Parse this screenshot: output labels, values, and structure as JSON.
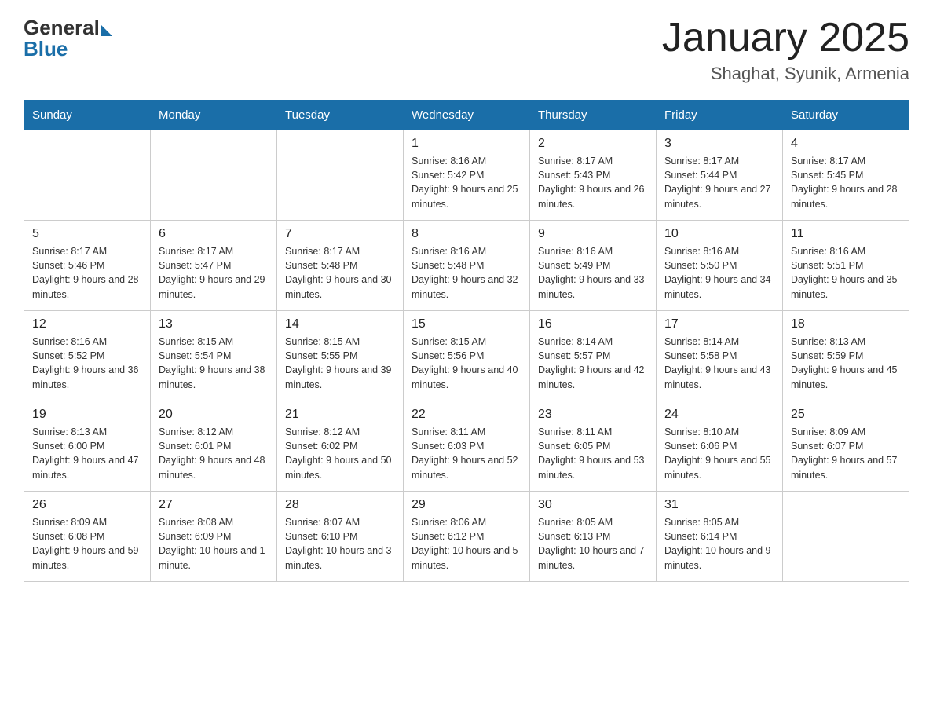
{
  "logo": {
    "general": "General",
    "blue": "Blue"
  },
  "title": "January 2025",
  "subtitle": "Shaghat, Syunik, Armenia",
  "weekdays": [
    "Sunday",
    "Monday",
    "Tuesday",
    "Wednesday",
    "Thursday",
    "Friday",
    "Saturday"
  ],
  "weeks": [
    [
      {
        "day": "",
        "info": ""
      },
      {
        "day": "",
        "info": ""
      },
      {
        "day": "",
        "info": ""
      },
      {
        "day": "1",
        "info": "Sunrise: 8:16 AM\nSunset: 5:42 PM\nDaylight: 9 hours\nand 25 minutes."
      },
      {
        "day": "2",
        "info": "Sunrise: 8:17 AM\nSunset: 5:43 PM\nDaylight: 9 hours\nand 26 minutes."
      },
      {
        "day": "3",
        "info": "Sunrise: 8:17 AM\nSunset: 5:44 PM\nDaylight: 9 hours\nand 27 minutes."
      },
      {
        "day": "4",
        "info": "Sunrise: 8:17 AM\nSunset: 5:45 PM\nDaylight: 9 hours\nand 28 minutes."
      }
    ],
    [
      {
        "day": "5",
        "info": "Sunrise: 8:17 AM\nSunset: 5:46 PM\nDaylight: 9 hours\nand 28 minutes."
      },
      {
        "day": "6",
        "info": "Sunrise: 8:17 AM\nSunset: 5:47 PM\nDaylight: 9 hours\nand 29 minutes."
      },
      {
        "day": "7",
        "info": "Sunrise: 8:17 AM\nSunset: 5:48 PM\nDaylight: 9 hours\nand 30 minutes."
      },
      {
        "day": "8",
        "info": "Sunrise: 8:16 AM\nSunset: 5:48 PM\nDaylight: 9 hours\nand 32 minutes."
      },
      {
        "day": "9",
        "info": "Sunrise: 8:16 AM\nSunset: 5:49 PM\nDaylight: 9 hours\nand 33 minutes."
      },
      {
        "day": "10",
        "info": "Sunrise: 8:16 AM\nSunset: 5:50 PM\nDaylight: 9 hours\nand 34 minutes."
      },
      {
        "day": "11",
        "info": "Sunrise: 8:16 AM\nSunset: 5:51 PM\nDaylight: 9 hours\nand 35 minutes."
      }
    ],
    [
      {
        "day": "12",
        "info": "Sunrise: 8:16 AM\nSunset: 5:52 PM\nDaylight: 9 hours\nand 36 minutes."
      },
      {
        "day": "13",
        "info": "Sunrise: 8:15 AM\nSunset: 5:54 PM\nDaylight: 9 hours\nand 38 minutes."
      },
      {
        "day": "14",
        "info": "Sunrise: 8:15 AM\nSunset: 5:55 PM\nDaylight: 9 hours\nand 39 minutes."
      },
      {
        "day": "15",
        "info": "Sunrise: 8:15 AM\nSunset: 5:56 PM\nDaylight: 9 hours\nand 40 minutes."
      },
      {
        "day": "16",
        "info": "Sunrise: 8:14 AM\nSunset: 5:57 PM\nDaylight: 9 hours\nand 42 minutes."
      },
      {
        "day": "17",
        "info": "Sunrise: 8:14 AM\nSunset: 5:58 PM\nDaylight: 9 hours\nand 43 minutes."
      },
      {
        "day": "18",
        "info": "Sunrise: 8:13 AM\nSunset: 5:59 PM\nDaylight: 9 hours\nand 45 minutes."
      }
    ],
    [
      {
        "day": "19",
        "info": "Sunrise: 8:13 AM\nSunset: 6:00 PM\nDaylight: 9 hours\nand 47 minutes."
      },
      {
        "day": "20",
        "info": "Sunrise: 8:12 AM\nSunset: 6:01 PM\nDaylight: 9 hours\nand 48 minutes."
      },
      {
        "day": "21",
        "info": "Sunrise: 8:12 AM\nSunset: 6:02 PM\nDaylight: 9 hours\nand 50 minutes."
      },
      {
        "day": "22",
        "info": "Sunrise: 8:11 AM\nSunset: 6:03 PM\nDaylight: 9 hours\nand 52 minutes."
      },
      {
        "day": "23",
        "info": "Sunrise: 8:11 AM\nSunset: 6:05 PM\nDaylight: 9 hours\nand 53 minutes."
      },
      {
        "day": "24",
        "info": "Sunrise: 8:10 AM\nSunset: 6:06 PM\nDaylight: 9 hours\nand 55 minutes."
      },
      {
        "day": "25",
        "info": "Sunrise: 8:09 AM\nSunset: 6:07 PM\nDaylight: 9 hours\nand 57 minutes."
      }
    ],
    [
      {
        "day": "26",
        "info": "Sunrise: 8:09 AM\nSunset: 6:08 PM\nDaylight: 9 hours\nand 59 minutes."
      },
      {
        "day": "27",
        "info": "Sunrise: 8:08 AM\nSunset: 6:09 PM\nDaylight: 10 hours\nand 1 minute."
      },
      {
        "day": "28",
        "info": "Sunrise: 8:07 AM\nSunset: 6:10 PM\nDaylight: 10 hours\nand 3 minutes."
      },
      {
        "day": "29",
        "info": "Sunrise: 8:06 AM\nSunset: 6:12 PM\nDaylight: 10 hours\nand 5 minutes."
      },
      {
        "day": "30",
        "info": "Sunrise: 8:05 AM\nSunset: 6:13 PM\nDaylight: 10 hours\nand 7 minutes."
      },
      {
        "day": "31",
        "info": "Sunrise: 8:05 AM\nSunset: 6:14 PM\nDaylight: 10 hours\nand 9 minutes."
      },
      {
        "day": "",
        "info": ""
      }
    ]
  ]
}
